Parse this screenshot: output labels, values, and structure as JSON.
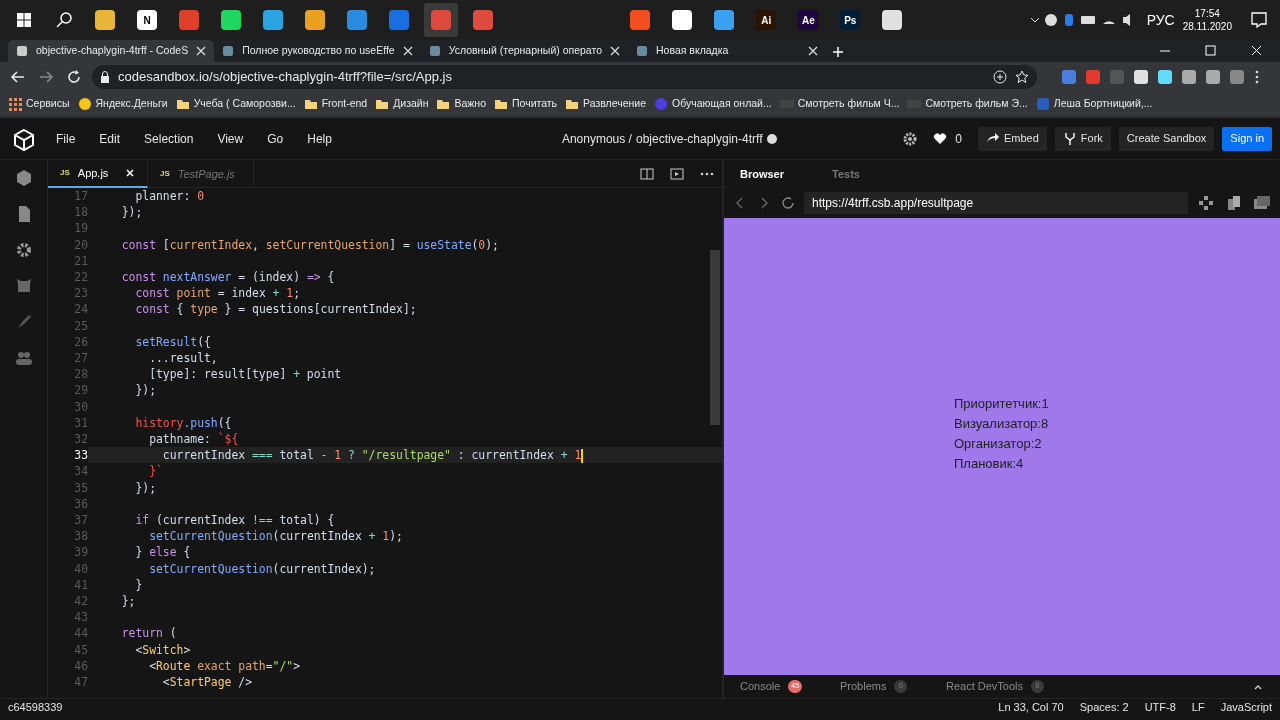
{
  "taskbar": {
    "apps": [
      {
        "color": "#e8b43a",
        "active": false
      },
      {
        "color": "#ffffff",
        "label": "N",
        "active": false
      },
      {
        "color": "#e0402a",
        "active": false
      },
      {
        "color": "#1ed760",
        "active": false
      },
      {
        "color": "#2aa3e0",
        "active": false
      },
      {
        "color": "#e8a020",
        "active": false
      },
      {
        "color": "#2a8be0",
        "active": false
      },
      {
        "color": "#1a6fe0",
        "active": false
      },
      {
        "color": "#dd4b3e",
        "active": true
      },
      {
        "color": "#dd4b3e",
        "active": false
      }
    ],
    "pinned": [
      {
        "color": "#f24e1e",
        "active": false
      },
      {
        "color": "#ffffff",
        "active": false
      },
      {
        "color": "#3aa0f0",
        "active": false
      },
      {
        "color": "#2b1500",
        "label": "Ai",
        "active": false
      },
      {
        "color": "#1f0740",
        "label": "Ae",
        "active": false
      },
      {
        "color": "#001e36",
        "label": "Ps",
        "active": false
      },
      {
        "color": "#e0e0e0",
        "active": false
      }
    ],
    "language": "РУС",
    "time": "17:54",
    "date": "28.11.2020"
  },
  "browser": {
    "tabs": [
      {
        "title": "objective-chaplygin-4trff - CodeS",
        "selected": true
      },
      {
        "title": "Полное руководство по useEffe",
        "selected": false
      },
      {
        "title": "Условный (тернарный) операто",
        "selected": false
      },
      {
        "title": "Новая вкладка",
        "selected": false
      }
    ],
    "address": "codesandbox.io/s/objective-chaplygin-4trff?file=/src/App.js",
    "bookmarks": [
      {
        "kind": "apps",
        "label": "Сервисы"
      },
      {
        "kind": "coin",
        "label": "Яндекс.Деньги"
      },
      {
        "kind": "folder",
        "label": "Учеба ( Саморозви..."
      },
      {
        "kind": "folder",
        "label": "Front-end"
      },
      {
        "kind": "folder",
        "label": "Дизайн"
      },
      {
        "kind": "folder",
        "label": "Важно"
      },
      {
        "kind": "folder",
        "label": "Почитать"
      },
      {
        "kind": "folder",
        "label": "Развлечение"
      },
      {
        "kind": "site",
        "label": "Обучающая онлай..."
      },
      {
        "kind": "hd",
        "label": "Смотреть фильм Ч..."
      },
      {
        "kind": "hd",
        "label": "Смотреть фильм Э..."
      },
      {
        "kind": "word",
        "label": "Леша Бортницкий,..."
      }
    ]
  },
  "sandbox": {
    "menu": [
      "File",
      "Edit",
      "Selection",
      "View",
      "Go",
      "Help"
    ],
    "owner": "Anonymous /",
    "name": "objective-chaplygin-4trff",
    "likes": "0",
    "buttons": [
      {
        "kind": "embed",
        "label": "Embed"
      },
      {
        "kind": "fork",
        "label": "Fork"
      },
      {
        "kind": "create",
        "label": "Create Sandbox"
      },
      {
        "kind": "signin",
        "label": "Sign in"
      }
    ],
    "editor_tabs": [
      {
        "badge": "JS",
        "label": "App.js",
        "selected": true
      },
      {
        "badge": "JS",
        "label": "TestPage.js",
        "selected": false
      }
    ],
    "lines": [
      {
        "n": "17",
        "current": false,
        "tokens": [
          {
            "text": "    planner: ",
            "kind": "p"
          },
          {
            "text": "0",
            "kind": "num"
          }
        ]
      },
      {
        "n": "18",
        "current": false,
        "tokens": [
          {
            "text": "  });",
            "kind": "p"
          }
        ]
      },
      {
        "n": "19",
        "current": false
      },
      {
        "n": "20",
        "current": false,
        "tokens": [
          {
            "text": "  const ",
            "kind": "kw"
          },
          {
            "text": "[",
            "kind": "p"
          },
          {
            "text": "currentIndex",
            "kind": "var"
          },
          {
            "text": ", ",
            "kind": "p"
          },
          {
            "text": "setCurrentQuestion",
            "kind": "var"
          },
          {
            "text": "] = ",
            "kind": "p"
          },
          {
            "text": "useState",
            "kind": "fn"
          },
          {
            "text": "(",
            "kind": "p"
          },
          {
            "text": "0",
            "kind": "num"
          },
          {
            "text": ");",
            "kind": "p"
          }
        ]
      },
      {
        "n": "21",
        "current": false
      },
      {
        "n": "22",
        "current": false,
        "tokens": [
          {
            "text": "  const ",
            "kind": "kw"
          },
          {
            "text": "nextAnswer",
            "kind": "fn"
          },
          {
            "text": " = (index) ",
            "kind": "p"
          },
          {
            "text": "=>",
            "kind": "kw"
          },
          {
            "text": " {",
            "kind": "p"
          }
        ]
      },
      {
        "n": "23",
        "current": false,
        "tokens": [
          {
            "text": "    const ",
            "kind": "kw"
          },
          {
            "text": "point",
            "kind": "var"
          },
          {
            "text": " = index ",
            "kind": "p"
          },
          {
            "text": "+ ",
            "kind": "op"
          },
          {
            "text": "1",
            "kind": "num"
          },
          {
            "text": ";",
            "kind": "p"
          }
        ]
      },
      {
        "n": "24",
        "current": false,
        "tokens": [
          {
            "text": "    const ",
            "kind": "kw"
          },
          {
            "text": "{ ",
            "kind": "p"
          },
          {
            "text": "type",
            "kind": "var"
          },
          {
            "text": " } = questions[currentIndex];",
            "kind": "p"
          }
        ]
      },
      {
        "n": "25",
        "current": false
      },
      {
        "n": "26",
        "current": false,
        "tokens": [
          {
            "text": "    setResult",
            "kind": "fn"
          },
          {
            "text": "({",
            "kind": "p"
          }
        ]
      },
      {
        "n": "27",
        "current": false,
        "tokens": [
          {
            "text": "      ...result,",
            "kind": "p"
          }
        ]
      },
      {
        "n": "28",
        "current": false,
        "tokens": [
          {
            "text": "      [type]: result[type] ",
            "kind": "p"
          },
          {
            "text": "+",
            "kind": "op"
          },
          {
            "text": " point",
            "kind": "p"
          }
        ]
      },
      {
        "n": "29",
        "current": false,
        "tokens": [
          {
            "text": "    });",
            "kind": "p"
          }
        ]
      },
      {
        "n": "30",
        "current": false
      },
      {
        "n": "31",
        "current": false,
        "tokens": [
          {
            "text": "    history",
            "kind": "red"
          },
          {
            "text": ".push",
            "kind": "fn"
          },
          {
            "text": "({",
            "kind": "p"
          }
        ]
      },
      {
        "n": "32",
        "current": false,
        "tokens": [
          {
            "text": "      pathname: ",
            "kind": "p"
          },
          {
            "text": "`${",
            "kind": "red"
          }
        ]
      },
      {
        "n": "33",
        "current": true,
        "tokens": [
          {
            "text": "        currentIndex ",
            "kind": "p"
          },
          {
            "text": "===",
            "kind": "op"
          },
          {
            "text": " total ",
            "kind": "p"
          },
          {
            "text": "- ",
            "kind": "op"
          },
          {
            "text": "1",
            "kind": "num"
          },
          {
            "text": " ? ",
            "kind": "op"
          },
          {
            "text": "\"/resultpage\"",
            "kind": "str"
          },
          {
            "text": " : currentIndex ",
            "kind": "p"
          },
          {
            "text": "+ ",
            "kind": "op"
          },
          {
            "text": "1",
            "kind": "num"
          }
        ]
      },
      {
        "n": "34",
        "current": false,
        "tokens": [
          {
            "text": "      }`",
            "kind": "red"
          }
        ]
      },
      {
        "n": "35",
        "current": false,
        "tokens": [
          {
            "text": "    });",
            "kind": "p"
          }
        ]
      },
      {
        "n": "36",
        "current": false
      },
      {
        "n": "37",
        "current": false,
        "tokens": [
          {
            "text": "    if",
            "kind": "kw"
          },
          {
            "text": " (currentIndex ",
            "kind": "p"
          },
          {
            "text": "!==",
            "kind": "op"
          },
          {
            "text": " total) {",
            "kind": "p"
          }
        ]
      },
      {
        "n": "38",
        "current": false,
        "tokens": [
          {
            "text": "      setCurrentQuestion",
            "kind": "fn"
          },
          {
            "text": "(currentIndex ",
            "kind": "p"
          },
          {
            "text": "+ ",
            "kind": "op"
          },
          {
            "text": "1",
            "kind": "num"
          },
          {
            "text": ");",
            "kind": "p"
          }
        ]
      },
      {
        "n": "39",
        "current": false,
        "tokens": [
          {
            "text": "    } ",
            "kind": "p"
          },
          {
            "text": "else",
            "kind": "kw"
          },
          {
            "text": " {",
            "kind": "p"
          }
        ]
      },
      {
        "n": "40",
        "current": false,
        "tokens": [
          {
            "text": "      setCurrentQuestion",
            "kind": "fn"
          },
          {
            "text": "(currentIndex);",
            "kind": "p"
          }
        ]
      },
      {
        "n": "41",
        "current": false,
        "tokens": [
          {
            "text": "    }",
            "kind": "p"
          }
        ]
      },
      {
        "n": "42",
        "current": false,
        "tokens": [
          {
            "text": "  };",
            "kind": "p"
          }
        ]
      },
      {
        "n": "43",
        "current": false
      },
      {
        "n": "44",
        "current": false,
        "tokens": [
          {
            "text": "  return",
            "kind": "kw"
          },
          {
            "text": " (",
            "kind": "p"
          }
        ]
      },
      {
        "n": "45",
        "current": false,
        "tokens": [
          {
            "text": "    <",
            "kind": "p"
          },
          {
            "text": "Switch",
            "kind": "tag"
          },
          {
            "text": ">",
            "kind": "p"
          }
        ]
      },
      {
        "n": "46",
        "current": false,
        "tokens": [
          {
            "text": "      <",
            "kind": "p"
          },
          {
            "text": "Route",
            "kind": "tag"
          },
          {
            "text": " exact path",
            "kind": "var"
          },
          {
            "text": "=",
            "kind": "p"
          },
          {
            "text": "\"/\"",
            "kind": "str"
          },
          {
            "text": ">",
            "kind": "p"
          }
        ]
      },
      {
        "n": "47",
        "current": false,
        "tokens": [
          {
            "text": "        <",
            "kind": "p"
          },
          {
            "text": "StartPage",
            "kind": "tag"
          },
          {
            "text": " />",
            "kind": "p"
          }
        ]
      }
    ],
    "preview_tabs": [
      {
        "label": "Browser",
        "selected": true
      },
      {
        "label": "Tests",
        "selected": false
      }
    ],
    "preview_url": "https://4trff.csb.app/resultpage",
    "result_lines": [
      "Приоритетчик:1",
      "Визуализатор:8",
      "Организатор:2",
      "Плановик:4"
    ],
    "devtools": [
      {
        "label": "Console",
        "count": "45",
        "alert": true
      },
      {
        "label": "Problems",
        "count": "0",
        "alert": false
      },
      {
        "label": "React DevTools",
        "count": "0",
        "alert": false
      }
    ]
  },
  "status_bar": {
    "commit": "c64598339",
    "items": [
      "Ln 33, Col 70",
      "Spaces: 2",
      "UTF-8",
      "LF",
      "JavaScript"
    ]
  }
}
